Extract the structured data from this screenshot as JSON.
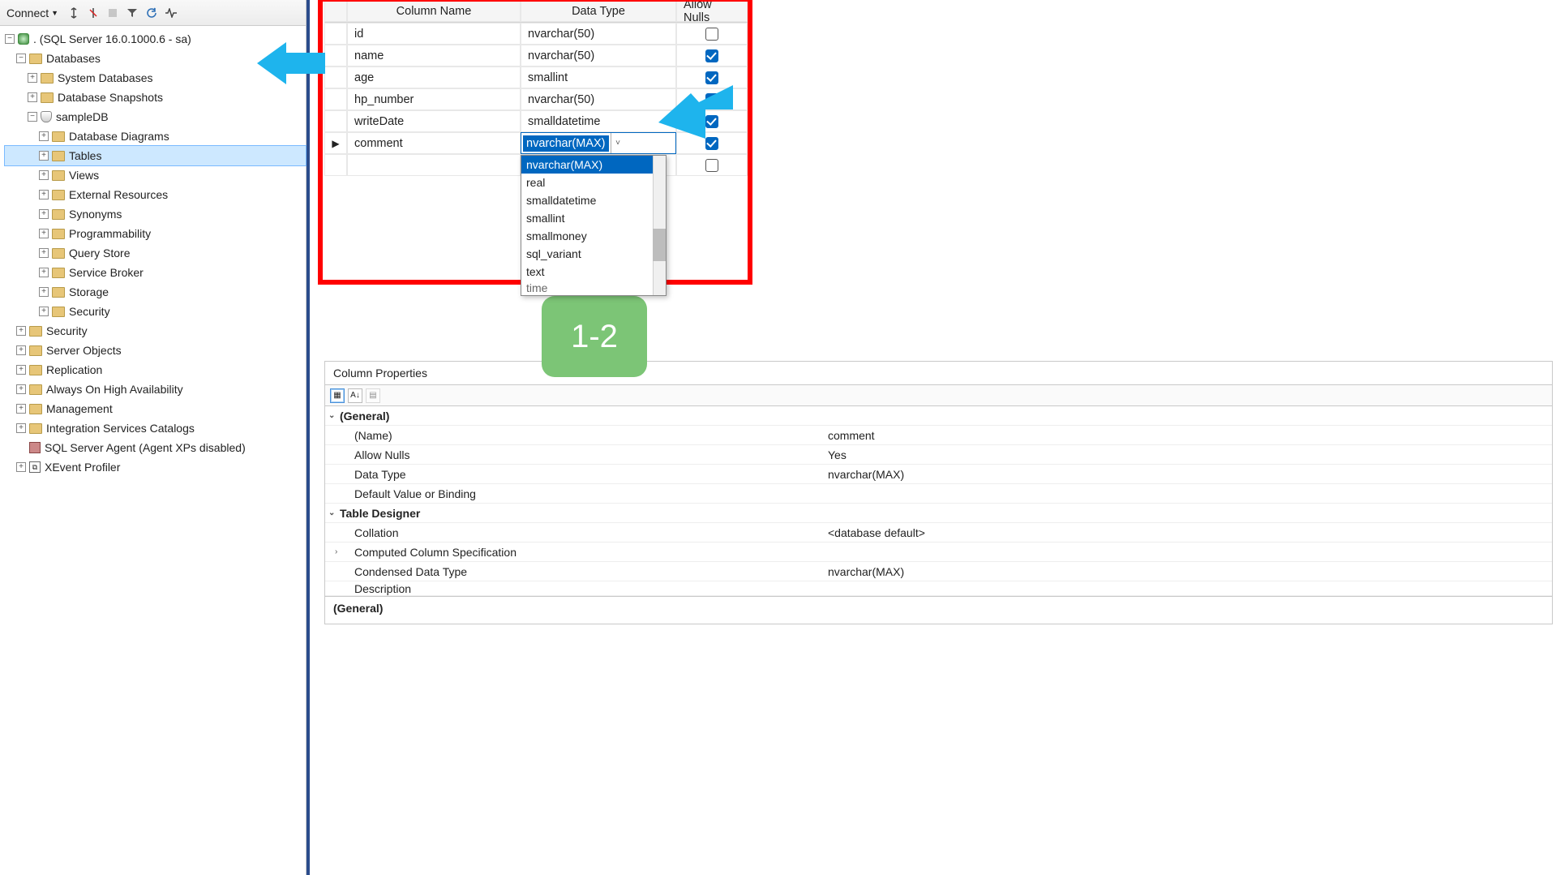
{
  "toolbar": {
    "connect_label": "Connect"
  },
  "tree": {
    "server": ". (SQL Server 16.0.1000.6 - sa)",
    "databases": "Databases",
    "sysdb": "System Databases",
    "dbsnap": "Database Snapshots",
    "sampleDB": "sampleDB",
    "dbdiag": "Database Diagrams",
    "tables": "Tables",
    "views": "Views",
    "extres": "External Resources",
    "syn": "Synonyms",
    "prog": "Programmability",
    "qs": "Query Store",
    "sb": "Service Broker",
    "storage": "Storage",
    "dbSecurity": "Security",
    "security": "Security",
    "sobj": "Server Objects",
    "repl": "Replication",
    "aoha": "Always On High Availability",
    "mgmt": "Management",
    "isc": "Integration Services Catalogs",
    "agent": "SQL Server Agent (Agent XPs disabled)",
    "xep": "XEvent Profiler"
  },
  "grid": {
    "headers": {
      "col": "Column Name",
      "dt": "Data Type",
      "an": "Allow Nulls"
    },
    "rows": [
      {
        "name": "id",
        "type": "nvarchar(50)",
        "null": false
      },
      {
        "name": "name",
        "type": "nvarchar(50)",
        "null": true
      },
      {
        "name": "age",
        "type": "smallint",
        "null": true
      },
      {
        "name": "hp_number",
        "type": "nvarchar(50)",
        "null": true
      },
      {
        "name": "writeDate",
        "type": "smalldatetime",
        "null": true
      },
      {
        "name": "comment",
        "type": "nvarchar(MAX)",
        "null": true
      }
    ],
    "new_null": false,
    "dropdown": [
      "nvarchar(MAX)",
      "real",
      "smalldatetime",
      "smallint",
      "smallmoney",
      "sql_variant",
      "text"
    ],
    "dropdown_peek": "time"
  },
  "badge": "1-2",
  "cprops": {
    "title": "Column Properties",
    "groups": {
      "general": "(General)",
      "name_l": "(Name)",
      "name_v": "comment",
      "an_l": "Allow Nulls",
      "an_v": "Yes",
      "dt_l": "Data Type",
      "dt_v": "nvarchar(MAX)",
      "dvb_l": "Default Value or Binding",
      "td": "Table Designer",
      "coll_l": "Collation",
      "coll_v": "<database default>",
      "ccs_l": "Computed Column Specification",
      "cdt_l": "Condensed Data Type",
      "cdt_v": "nvarchar(MAX)",
      "desc_l": "Description"
    },
    "footer": "(General)"
  }
}
